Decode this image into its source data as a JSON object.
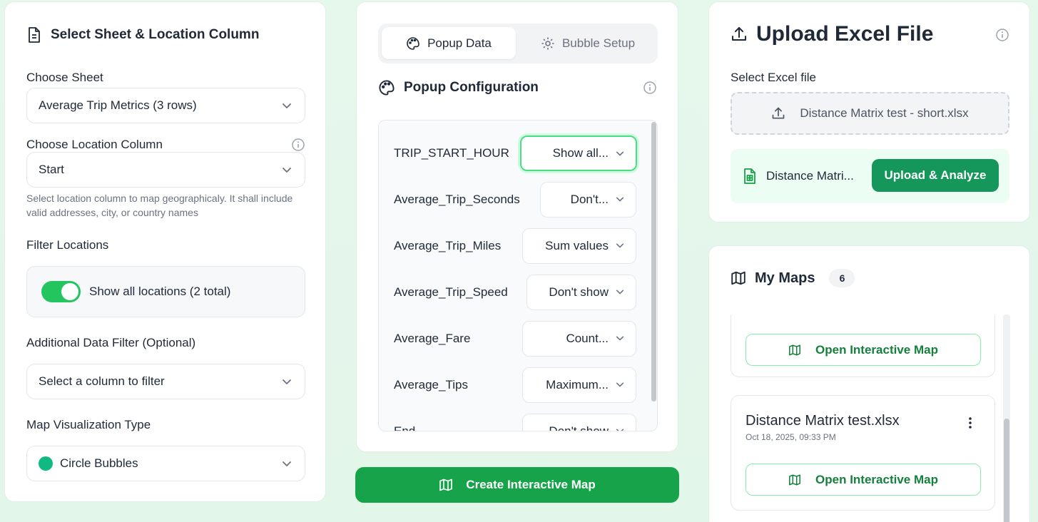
{
  "left": {
    "title": "Select Sheet & Location Column",
    "choose_sheet_label": "Choose Sheet",
    "sheet_value": "Average Trip Metrics (3 rows)",
    "choose_location_label": "Choose Location Column",
    "location_value": "Start",
    "location_help": "Select location column to map geographicaly. It shall include valid addresses, city, or country names",
    "filter_label": "Filter Locations",
    "toggle_label": "Show all locations (2 total)",
    "toggle_on": true,
    "additional_filter_label": "Additional Data Filter (Optional)",
    "additional_filter_placeholder": "Select a column to filter",
    "viz_type_label": "Map Visualization Type",
    "viz_type_value": "Circle Bubbles"
  },
  "middle": {
    "tabs": [
      {
        "label": "Popup Data",
        "icon": "palette-icon",
        "active": true
      },
      {
        "label": "Bubble Setup",
        "icon": "gear-icon",
        "active": false
      }
    ],
    "section_title": "Popup Configuration",
    "rows": [
      {
        "name": "TRIP_START_HOUR",
        "value": "Show all..."
      },
      {
        "name": "Average_Trip_Seconds",
        "value": "Don't..."
      },
      {
        "name": "Average_Trip_Miles",
        "value": "Sum values"
      },
      {
        "name": "Average_Trip_Speed",
        "value": "Don't show"
      },
      {
        "name": "Average_Fare",
        "value": "Count..."
      },
      {
        "name": "Average_Tips",
        "value": "Maximum..."
      },
      {
        "name": "End",
        "value": "Don't show"
      }
    ],
    "create_button": "Create Interactive Map"
  },
  "upload": {
    "title": "Upload Excel File",
    "select_label": "Select Excel file",
    "dropzone_filename": "Distance Matrix test - short.xlsx",
    "selected_file": "Distance Matri...",
    "upload_button": "Upload & Analyze"
  },
  "maps": {
    "title": "My Maps",
    "count": "6",
    "items": [
      {
        "name": "",
        "date": "",
        "open_label": "Open Interactive Map"
      },
      {
        "name": "Distance Matrix test.xlsx",
        "date": "Oct 18, 2025, 09:33 PM",
        "open_label": "Open Interactive Map"
      }
    ]
  },
  "colors": {
    "accent": "#16a34a",
    "toggle": "#22c55e",
    "upload_button": "#15965a",
    "bubble_dot": "#10b981"
  }
}
